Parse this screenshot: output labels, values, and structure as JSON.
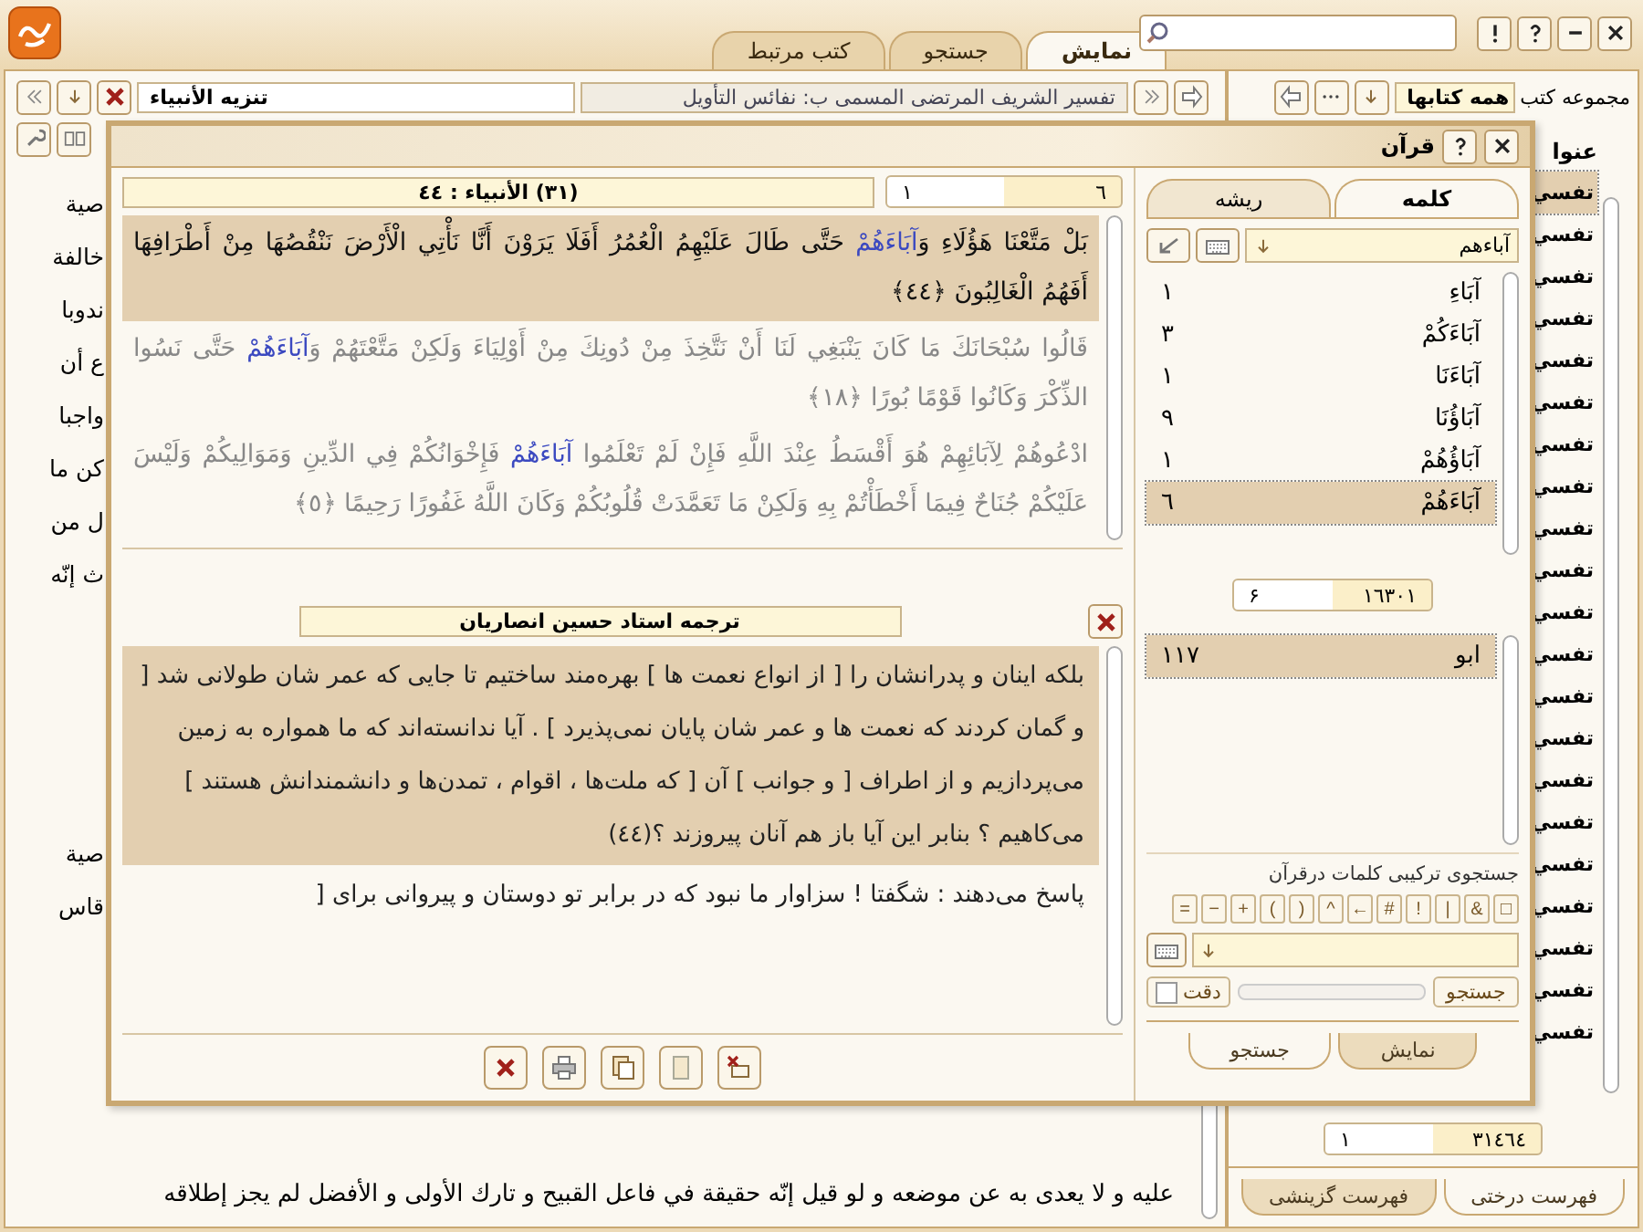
{
  "app_tabs": [
    {
      "label": "نمایش",
      "selected": true
    },
    {
      "label": "جستجو",
      "selected": false
    },
    {
      "label": "کتب مرتبط",
      "selected": false
    }
  ],
  "book_bar": {
    "section": "تنزیه الأنبیاء",
    "book_title": "تفسیر الشریف المرتضی المسمی ب: نفائس التأویل"
  },
  "collection": {
    "label": "مجموعه کتب",
    "value": "همه کتابها"
  },
  "document": {
    "upper_lines": [
      "صية",
      "خالفة",
      "ندوبا",
      "ع أن",
      "واجبا",
      "كن ما",
      "ل من",
      "ث إنّه"
    ],
    "lower_lines": [
      "صية",
      "قاس"
    ],
    "last_line": "عليه و لا يعدى به عن موضعه و لو قيل إنّه حقيقة في فاعل القبيح و تارك الأولى و الأفضل لم يجز إطلاقه"
  },
  "titles_panel": {
    "heading": "عنوا",
    "items": [
      {
        "text": "تفسي",
        "selected": true
      },
      {
        "text": "تفسي",
        "selected": false
      },
      {
        "text": "تفسي",
        "selected": false
      },
      {
        "text": "تفسي",
        "selected": false
      },
      {
        "text": "تفسي",
        "selected": false
      },
      {
        "text": "تفسي",
        "selected": false
      },
      {
        "text": "تفسي",
        "selected": false
      },
      {
        "text": "تفسي",
        "selected": false
      },
      {
        "text": "تفسي",
        "selected": false
      },
      {
        "text": "تفسي",
        "selected": false
      },
      {
        "text": "تفسي",
        "selected": false
      },
      {
        "text": "تفسي",
        "selected": false
      },
      {
        "text": "تفسي",
        "selected": false
      },
      {
        "text": "تفسي",
        "selected": false
      },
      {
        "text": "تفسي",
        "selected": false
      },
      {
        "text": "تفسي",
        "selected": false
      },
      {
        "text": "تفسي",
        "selected": false
      },
      {
        "text": "تفسي",
        "selected": false
      },
      {
        "text": "تفسي",
        "selected": false
      },
      {
        "text": "تفسي",
        "selected": false
      },
      {
        "text": "تفسي",
        "selected": false
      }
    ],
    "pager": {
      "total": "٣١٤٦٤",
      "current": "١"
    },
    "tabs": [
      {
        "label": "فهرست درختی",
        "selected": true
      },
      {
        "label": "فهرست گزینشی",
        "selected": false
      }
    ]
  },
  "quran_dialog": {
    "title": "قرآن",
    "pager": {
      "total": "٦",
      "current": "١"
    },
    "location": "(٣١) الأنبیاء : ٤٤",
    "verses": [
      {
        "selected": true,
        "before": "بَلْ مَتَّعْنَا هَؤُلَاءِ وَ",
        "match": "آبَاءَهُمْ",
        "after": " حَتَّى طَالَ عَلَيْهِمُ الْعُمُرُ أَفَلَا يَرَوْنَ أَنَّا نَأْتِي الْأَرْضَ نَنْقُصُهَا مِنْ أَطْرَافِهَا أَفَهُمُ الْغَالِبُونَ ﴿٤٤﴾"
      },
      {
        "selected": false,
        "before": "قَالُوا سُبْحَانَكَ مَا كَانَ يَنْبَغِي لَنَا أَنْ نَتَّخِذَ مِنْ دُونِكَ مِنْ أَوْلِيَاءَ وَلَكِنْ مَتَّعْتَهُمْ وَ",
        "match": "آبَاءَهُمْ",
        "after": " حَتَّى نَسُوا الذِّكْرَ وَكَانُوا قَوْمًا بُورًا ﴿١٨﴾"
      },
      {
        "selected": false,
        "before": "ادْعُوهُمْ لِآبَائِهِمْ هُوَ أَقْسَطُ عِنْدَ اللَّهِ فَإِنْ لَمْ تَعْلَمُوا ",
        "match": "آبَاءَهُمْ",
        "after": " فَإِخْوَانُكُمْ فِي الدِّينِ وَمَوَالِيكُمْ وَلَيْسَ عَلَيْكُمْ جُنَاحٌ فِيمَا أَخْطَأْتُمْ بِهِ وَلَكِنْ مَا تَعَمَّدَتْ قُلُوبُكُمْ وَكَانَ اللَّهُ غَفُورًا رَحِيمًا ﴿٥﴾"
      }
    ],
    "translation": {
      "title": "ترجمه استاد حسین انصاریان",
      "paragraphs": [
        {
          "selected": true,
          "text": "بلکه اینان و پدرانشان را [ از انواع نعمت ها ] بهره‌مند ساختیم تا جایی که عمر شان طولانی شد [ و گمان کردند که نعمت ها و عمر شان پایان نمی‌پذیرد ] . آیا ندانسته‌اند که ما همواره به زمین می‌پردازیم و از اطراف [ و جوانب ] آن [ که ملت‌ها ، اقوام ، تمدن‌ها و دانشمندانش هستند ] می‌کاهیم ؟ بنابر این آیا باز هم آنان پیروزند ؟(٤٤)"
        },
        {
          "selected": false,
          "text": "پاسخ می‌دهند : شگفتا ! سزاوار ما نبود که در برابر تو دوستان و پیروانی برای ["
        }
      ]
    },
    "side_tabs": [
      {
        "label": "کلمه",
        "selected": true
      },
      {
        "label": "ریشه",
        "selected": false
      }
    ],
    "word_search": {
      "value": "آباءهم"
    },
    "words": [
      {
        "word": "آبَاءِ",
        "count": "١",
        "selected": false
      },
      {
        "word": "آبَاءَكُمْ",
        "count": "٣",
        "selected": false
      },
      {
        "word": "آبَاءَنَا",
        "count": "١",
        "selected": false
      },
      {
        "word": "آبَاؤُنَا",
        "count": "٩",
        "selected": false
      },
      {
        "word": "آبَاؤُهُمْ",
        "count": "١",
        "selected": false
      },
      {
        "word": "آبَاءَهُمْ",
        "count": "٦",
        "selected": true
      }
    ],
    "words_pager": {
      "total": "١٦٣٠١",
      "current": "۶"
    },
    "roots": [
      {
        "word": "ابو",
        "count": "١١٧",
        "selected": true
      }
    ],
    "combined_search": {
      "label": "جستجوی ترکیبی کلمات درقرآن",
      "operators": [
        "□",
        "&",
        "|",
        "!",
        "#",
        "←",
        "^",
        ")",
        "(",
        "+",
        "−",
        "="
      ],
      "button": "جستجو",
      "progress": {
        "level": 0
      },
      "exact": {
        "label": "دقت",
        "checked": false
      }
    },
    "bottom_tabs": [
      {
        "label": "نمایش",
        "selected": false
      },
      {
        "label": "جستجو",
        "selected": true
      }
    ]
  }
}
